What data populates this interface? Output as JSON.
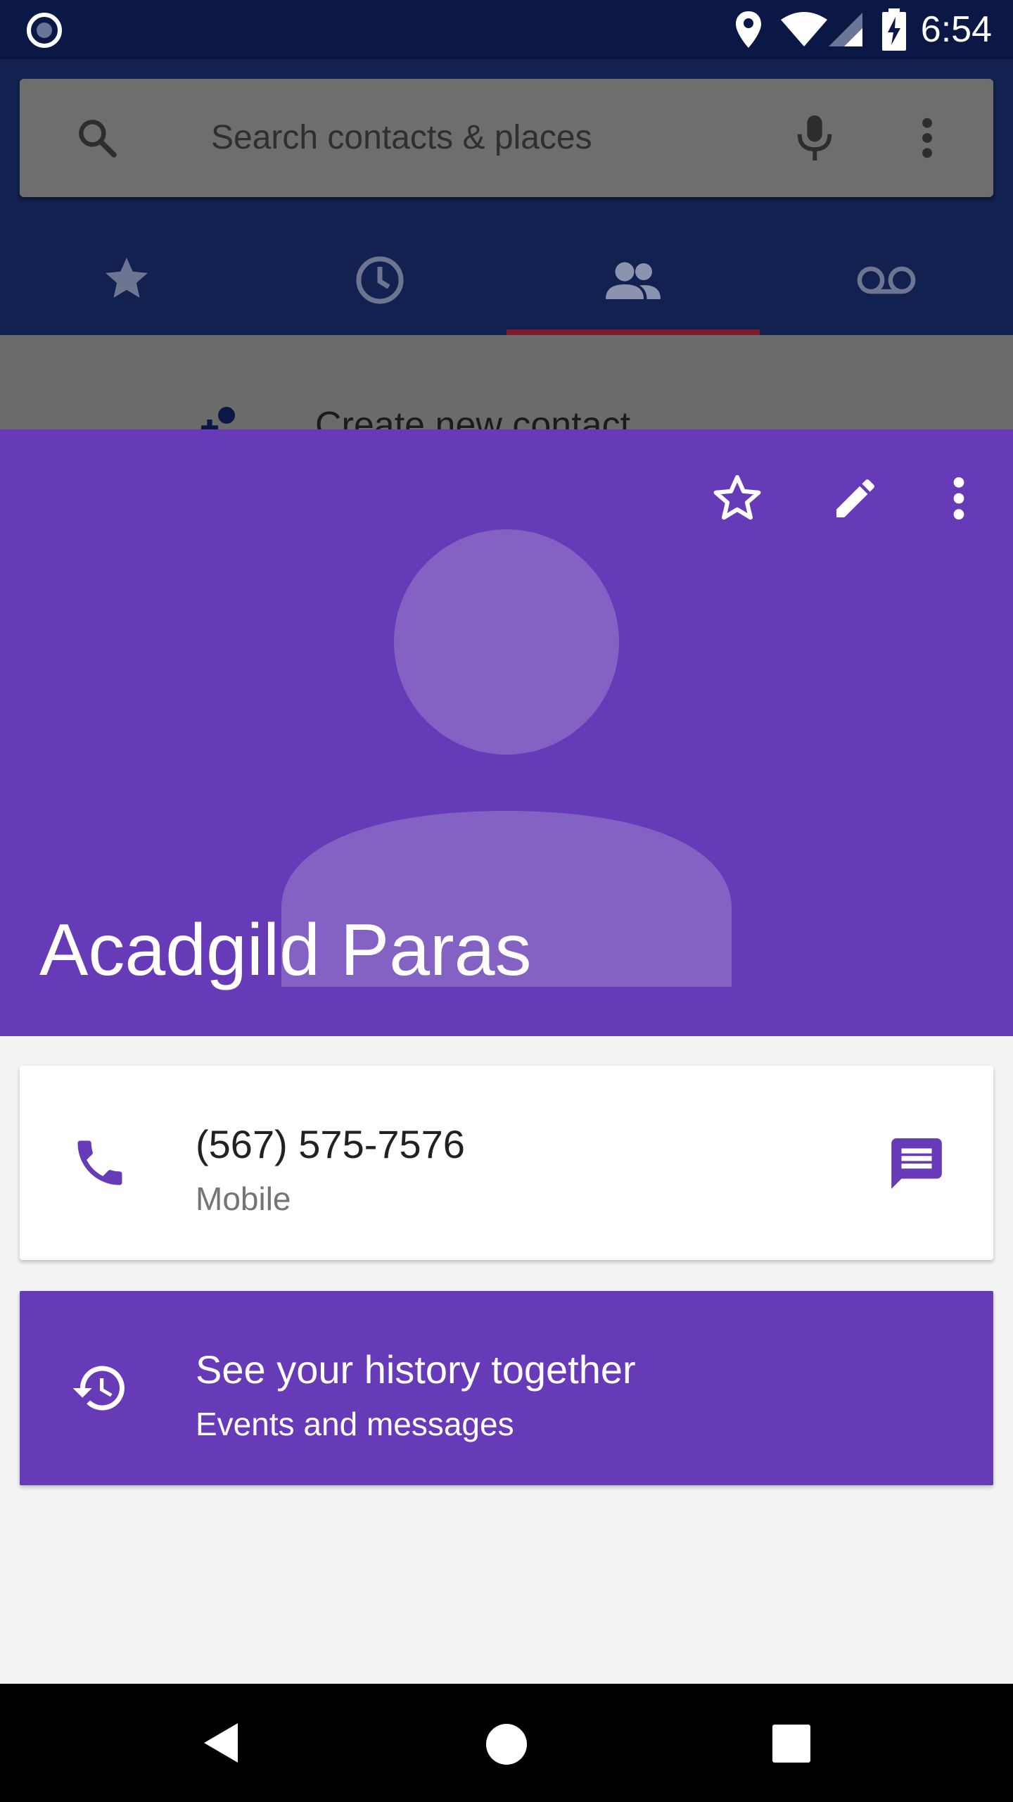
{
  "status_bar": {
    "time": "6:54",
    "icons": [
      "record-icon",
      "location-icon",
      "wifi-icon",
      "signal-icon",
      "battery-charging-icon"
    ]
  },
  "dialer": {
    "search": {
      "placeholder": "Search contacts & places"
    },
    "tabs": [
      {
        "icon": "star-icon",
        "name": "favorites"
      },
      {
        "icon": "clock-icon",
        "name": "recents"
      },
      {
        "icon": "people-icon",
        "name": "contacts",
        "selected": true
      },
      {
        "icon": "voicemail-icon",
        "name": "voicemail"
      }
    ],
    "list_item_partial": "Create new contact"
  },
  "contact": {
    "name": "Acadgild Paras",
    "header_color": "#673ab7",
    "actions": [
      "star-outline-icon",
      "edit-icon",
      "more-vert-icon"
    ]
  },
  "phone_card": {
    "number": "(567) 575-7576",
    "type": "Mobile"
  },
  "history_card": {
    "title": "See your history together",
    "subtitle": "Events and messages"
  },
  "colors": {
    "accent": "#673ab7",
    "status_bar": "#0b1846"
  }
}
